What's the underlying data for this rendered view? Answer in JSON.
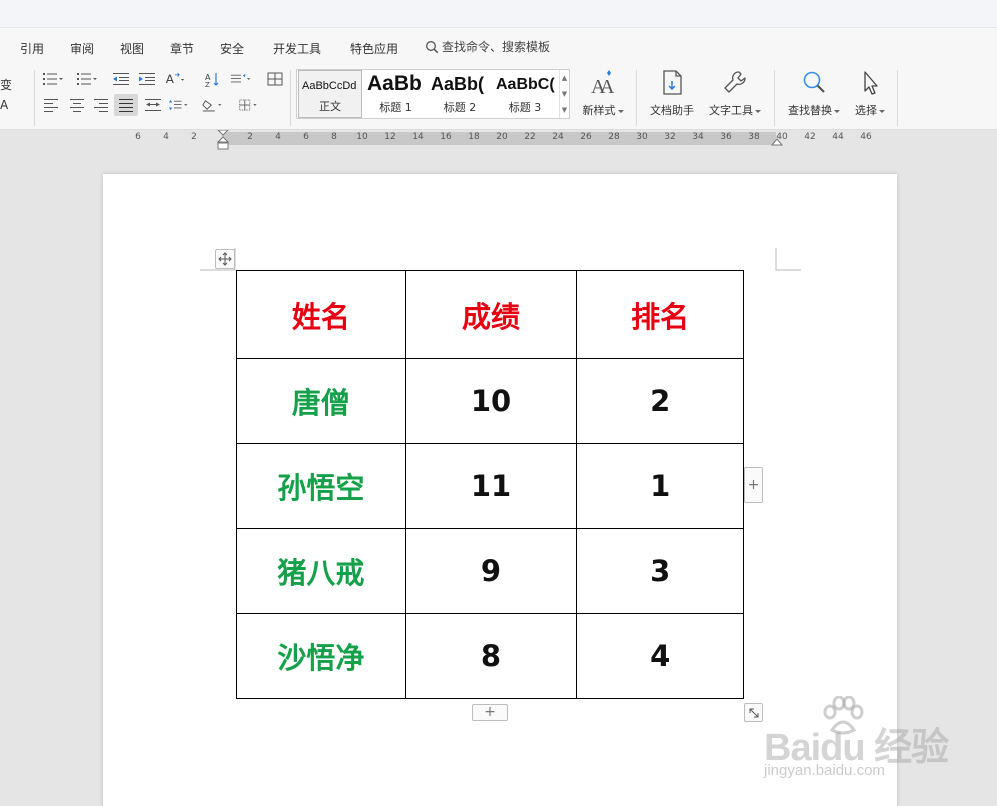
{
  "menu": {
    "tabs": [
      "引用",
      "审阅",
      "视图",
      "章节",
      "安全",
      "开发工具",
      "特色应用"
    ],
    "search_label": "查找命令、搜索模板"
  },
  "ribbon": {
    "partial_labels": [
      "变",
      "A"
    ],
    "styles": [
      {
        "sample": "AaBbCcDd",
        "caption": "正文"
      },
      {
        "sample": "AaBb",
        "caption": "标题 1"
      },
      {
        "sample": "AaBb(",
        "caption": "标题 2"
      },
      {
        "sample": "AaBbC(",
        "caption": "标题 3"
      }
    ],
    "new_style": "新样式",
    "doc_helper": "文档助手",
    "text_tools": "文字工具",
    "find_replace": "查找替换",
    "select": "选择"
  },
  "ruler": {
    "left_numbers": [
      "6",
      "4",
      "2"
    ],
    "numbers": [
      "2",
      "4",
      "6",
      "8",
      "10",
      "12",
      "14",
      "16",
      "18",
      "20",
      "22",
      "24",
      "26",
      "28",
      "30",
      "32",
      "34",
      "36",
      "38",
      "40",
      "42",
      "44",
      "46"
    ]
  },
  "table": {
    "headers": [
      "姓名",
      "成绩",
      "排名"
    ],
    "rows": [
      {
        "name": "唐僧",
        "score": "10",
        "rank": "2"
      },
      {
        "name": "孙悟空",
        "score": "11",
        "rank": "1"
      },
      {
        "name": "猪八戒",
        "score": "9",
        "rank": "3"
      },
      {
        "name": "沙悟净",
        "score": "8",
        "rank": "4"
      }
    ],
    "add_symbol": "+"
  },
  "colors": {
    "header_text": "#e60012",
    "name_text": "#14a14a",
    "value_text": "#111111"
  },
  "watermark": {
    "brand": "Baidu 经验",
    "url": "jingyan.baidu.com"
  }
}
